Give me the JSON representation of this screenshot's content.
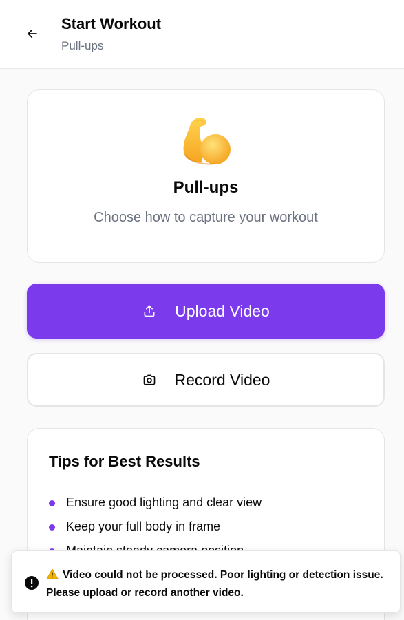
{
  "header": {
    "title": "Start Workout",
    "subtitle": "Pull-ups",
    "back_icon": "arrow-left-icon"
  },
  "hero": {
    "icon": "flexed-biceps-icon",
    "title": "Pull-ups",
    "subtitle": "Choose how to capture your workout"
  },
  "actions": {
    "upload_label": "Upload Video",
    "upload_icon": "upload-icon",
    "record_label": "Record Video",
    "record_icon": "camera-icon"
  },
  "tips": {
    "title": "Tips for Best Results",
    "items": [
      "Ensure good lighting and clear view",
      "Keep your full body in frame",
      "Maintain steady camera position"
    ]
  },
  "toast": {
    "icon": "alert-circle-icon",
    "warning_icon": "warning-icon",
    "message": "Video could not be processed. Poor lighting or detection issue. Please upload or record another video."
  },
  "colors": {
    "accent": "#7c3aed",
    "muted_text": "#6b7280",
    "border": "#e5e5e7"
  }
}
